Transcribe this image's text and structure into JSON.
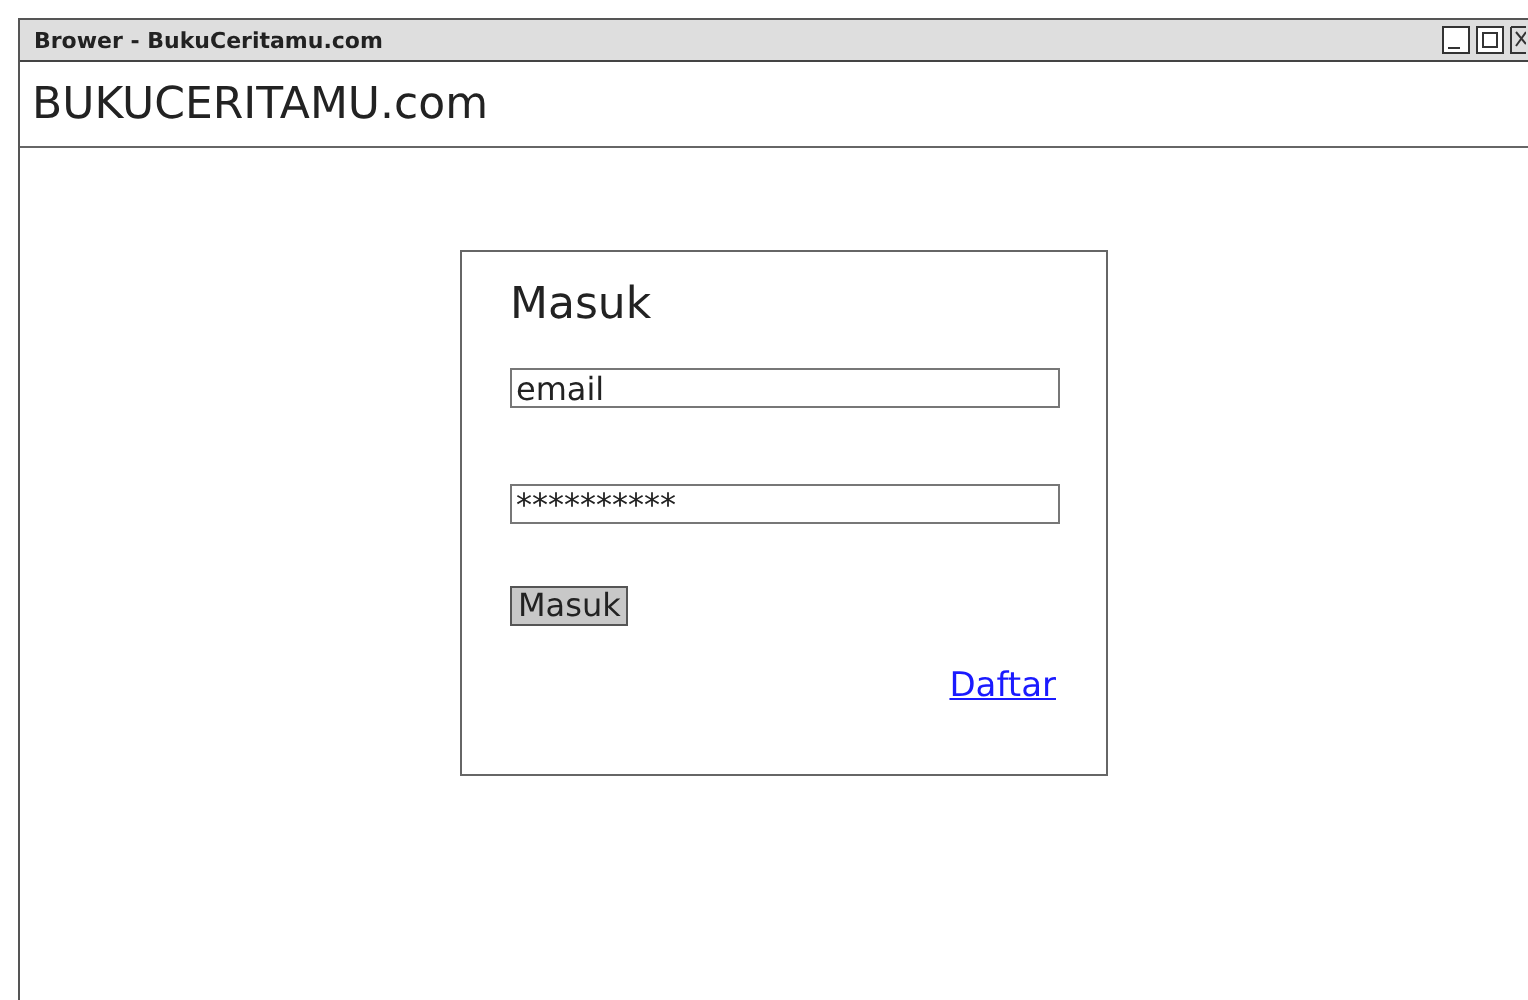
{
  "window": {
    "title": "Brower - BukuCeritamu.com"
  },
  "header": {
    "site_name": "BUKUCERITAMU.com"
  },
  "login": {
    "title": "Masuk",
    "email_field": {
      "value": "email"
    },
    "password_field": {
      "value": "**********"
    },
    "submit_button": "Masuk",
    "register_link": "Daftar"
  }
}
